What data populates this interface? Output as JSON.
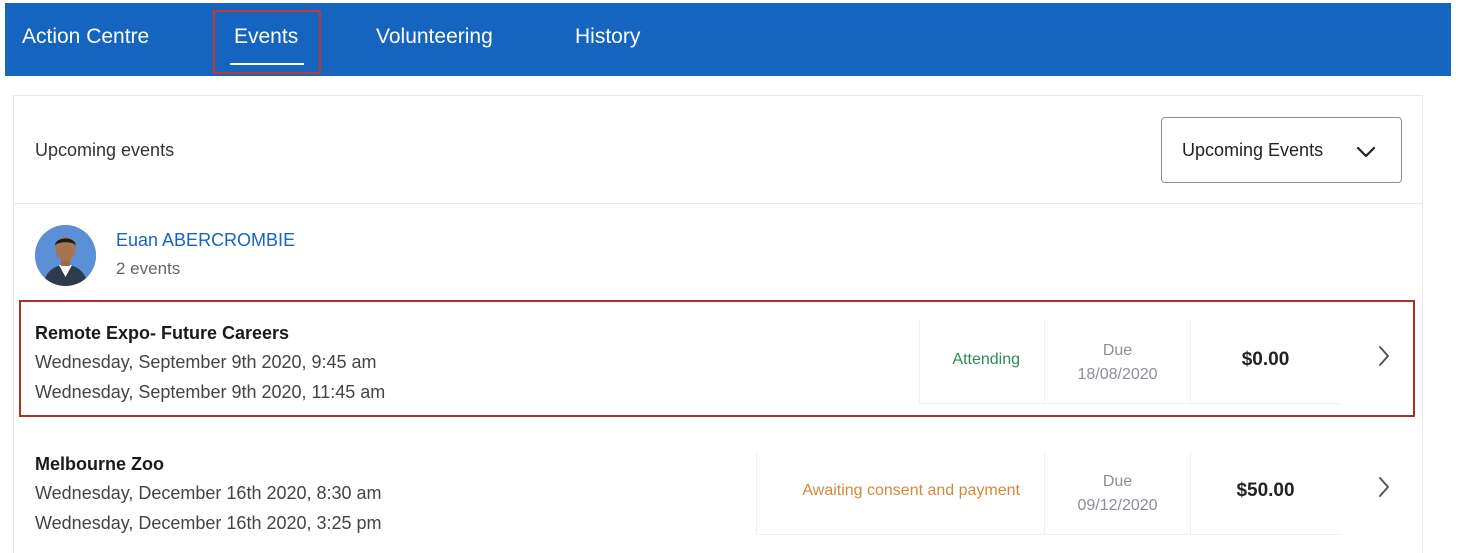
{
  "nav": {
    "tabs": [
      {
        "label": "Action Centre"
      },
      {
        "label": "Events",
        "active": true
      },
      {
        "label": "Volunteering"
      },
      {
        "label": "History"
      }
    ]
  },
  "section": {
    "title": "Upcoming events",
    "filter": {
      "selected": "Upcoming Events"
    }
  },
  "person": {
    "name": "Euan ABERCROMBIE",
    "count": "2 events"
  },
  "events": [
    {
      "title": "Remote Expo- Future Careers",
      "start": "Wednesday, September 9th 2020, 9:45 am",
      "end": "Wednesday, September 9th 2020, 11:45 am",
      "status": "Attending",
      "due_label": "Due",
      "due_date": "18/08/2020",
      "amount": "$0.00"
    },
    {
      "title": "Melbourne Zoo",
      "start": "Wednesday, December 16th 2020, 8:30 am",
      "end": "Wednesday, December 16th 2020, 3:25 pm",
      "status": "Awaiting consent and payment",
      "due_label": "Due",
      "due_date": "09/12/2020",
      "amount": "$50.00"
    }
  ],
  "colors": {
    "nav_bg": "#1565c0",
    "link": "#1565c0",
    "status_attending": "#2e8b57",
    "status_awaiting": "#d4883a",
    "highlight": "#a93226"
  },
  "icons": {
    "filter": "chevron-down-icon",
    "row": "chevron-right-icon",
    "avatar": "user-avatar"
  }
}
